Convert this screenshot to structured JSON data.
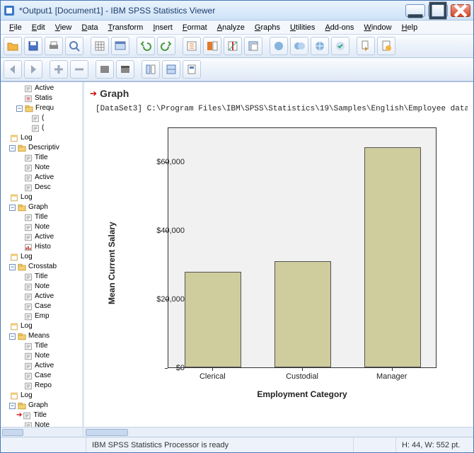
{
  "window": {
    "title": "*Output1 [Document1] - IBM SPSS Statistics Viewer"
  },
  "menu": [
    "File",
    "Edit",
    "View",
    "Data",
    "Transform",
    "Insert",
    "Format",
    "Analyze",
    "Graphs",
    "Utilities",
    "Add-ons",
    "Window",
    "Help"
  ],
  "outline": [
    {
      "indent": 3,
      "icon": "note",
      "label": "Active"
    },
    {
      "indent": 3,
      "icon": "stat",
      "label": "Statis"
    },
    {
      "indent": 2,
      "pm": "-",
      "icon": "folder",
      "label": "Frequ"
    },
    {
      "indent": 4,
      "icon": "note",
      "label": "("
    },
    {
      "indent": 4,
      "icon": "note",
      "label": "("
    },
    {
      "indent": 1,
      "icon": "log",
      "label": "Log"
    },
    {
      "indent": 1,
      "pm": "-",
      "icon": "folder",
      "label": "Descriptiv"
    },
    {
      "indent": 3,
      "icon": "note",
      "label": "Title"
    },
    {
      "indent": 3,
      "icon": "note",
      "label": "Note"
    },
    {
      "indent": 3,
      "icon": "note",
      "label": "Active"
    },
    {
      "indent": 3,
      "icon": "note",
      "label": "Desc"
    },
    {
      "indent": 1,
      "icon": "log",
      "label": "Log"
    },
    {
      "indent": 1,
      "pm": "-",
      "icon": "folder",
      "label": "Graph"
    },
    {
      "indent": 3,
      "icon": "note",
      "label": "Title"
    },
    {
      "indent": 3,
      "icon": "note",
      "label": "Note"
    },
    {
      "indent": 3,
      "icon": "note",
      "label": "Active"
    },
    {
      "indent": 3,
      "icon": "hist",
      "label": "Histo"
    },
    {
      "indent": 1,
      "icon": "log",
      "label": "Log"
    },
    {
      "indent": 1,
      "pm": "-",
      "icon": "folder",
      "label": "Crosstab"
    },
    {
      "indent": 3,
      "icon": "note",
      "label": "Title"
    },
    {
      "indent": 3,
      "icon": "note",
      "label": "Note"
    },
    {
      "indent": 3,
      "icon": "note",
      "label": "Active"
    },
    {
      "indent": 3,
      "icon": "note",
      "label": "Case"
    },
    {
      "indent": 3,
      "icon": "note",
      "label": "Emp"
    },
    {
      "indent": 1,
      "icon": "log",
      "label": "Log"
    },
    {
      "indent": 1,
      "pm": "-",
      "icon": "folder",
      "label": "Means"
    },
    {
      "indent": 3,
      "icon": "note",
      "label": "Title"
    },
    {
      "indent": 3,
      "icon": "note",
      "label": "Note"
    },
    {
      "indent": 3,
      "icon": "note",
      "label": "Active"
    },
    {
      "indent": 3,
      "icon": "note",
      "label": "Case"
    },
    {
      "indent": 3,
      "icon": "note",
      "label": "Repo"
    },
    {
      "indent": 1,
      "icon": "log",
      "label": "Log"
    },
    {
      "indent": 1,
      "pm": "-",
      "icon": "folder",
      "label": "Graph"
    },
    {
      "indent": 3,
      "icon": "note",
      "label": "Title",
      "red": true
    },
    {
      "indent": 3,
      "icon": "note",
      "label": "Note"
    }
  ],
  "content": {
    "graph_label": "Graph",
    "dataset_line": "[DataSet3] C:\\Program Files\\IBM\\SPSS\\Statistics\\19\\Samples\\English\\Employee data."
  },
  "chart_data": {
    "type": "bar",
    "categories": [
      "Clerical",
      "Custodial",
      "Manager"
    ],
    "values": [
      27800,
      30900,
      64000
    ],
    "xlabel": "Employment Category",
    "ylabel": "Mean Current Salary",
    "ylim": [
      0,
      70000
    ],
    "yticks": [
      0,
      20000,
      40000,
      60000
    ],
    "ytick_labels": [
      "$0",
      "$20,000",
      "$40,000",
      "$60,000"
    ]
  },
  "status": {
    "processor": "IBM SPSS Statistics Processor is ready",
    "dims": "H: 44, W: 552 pt."
  }
}
